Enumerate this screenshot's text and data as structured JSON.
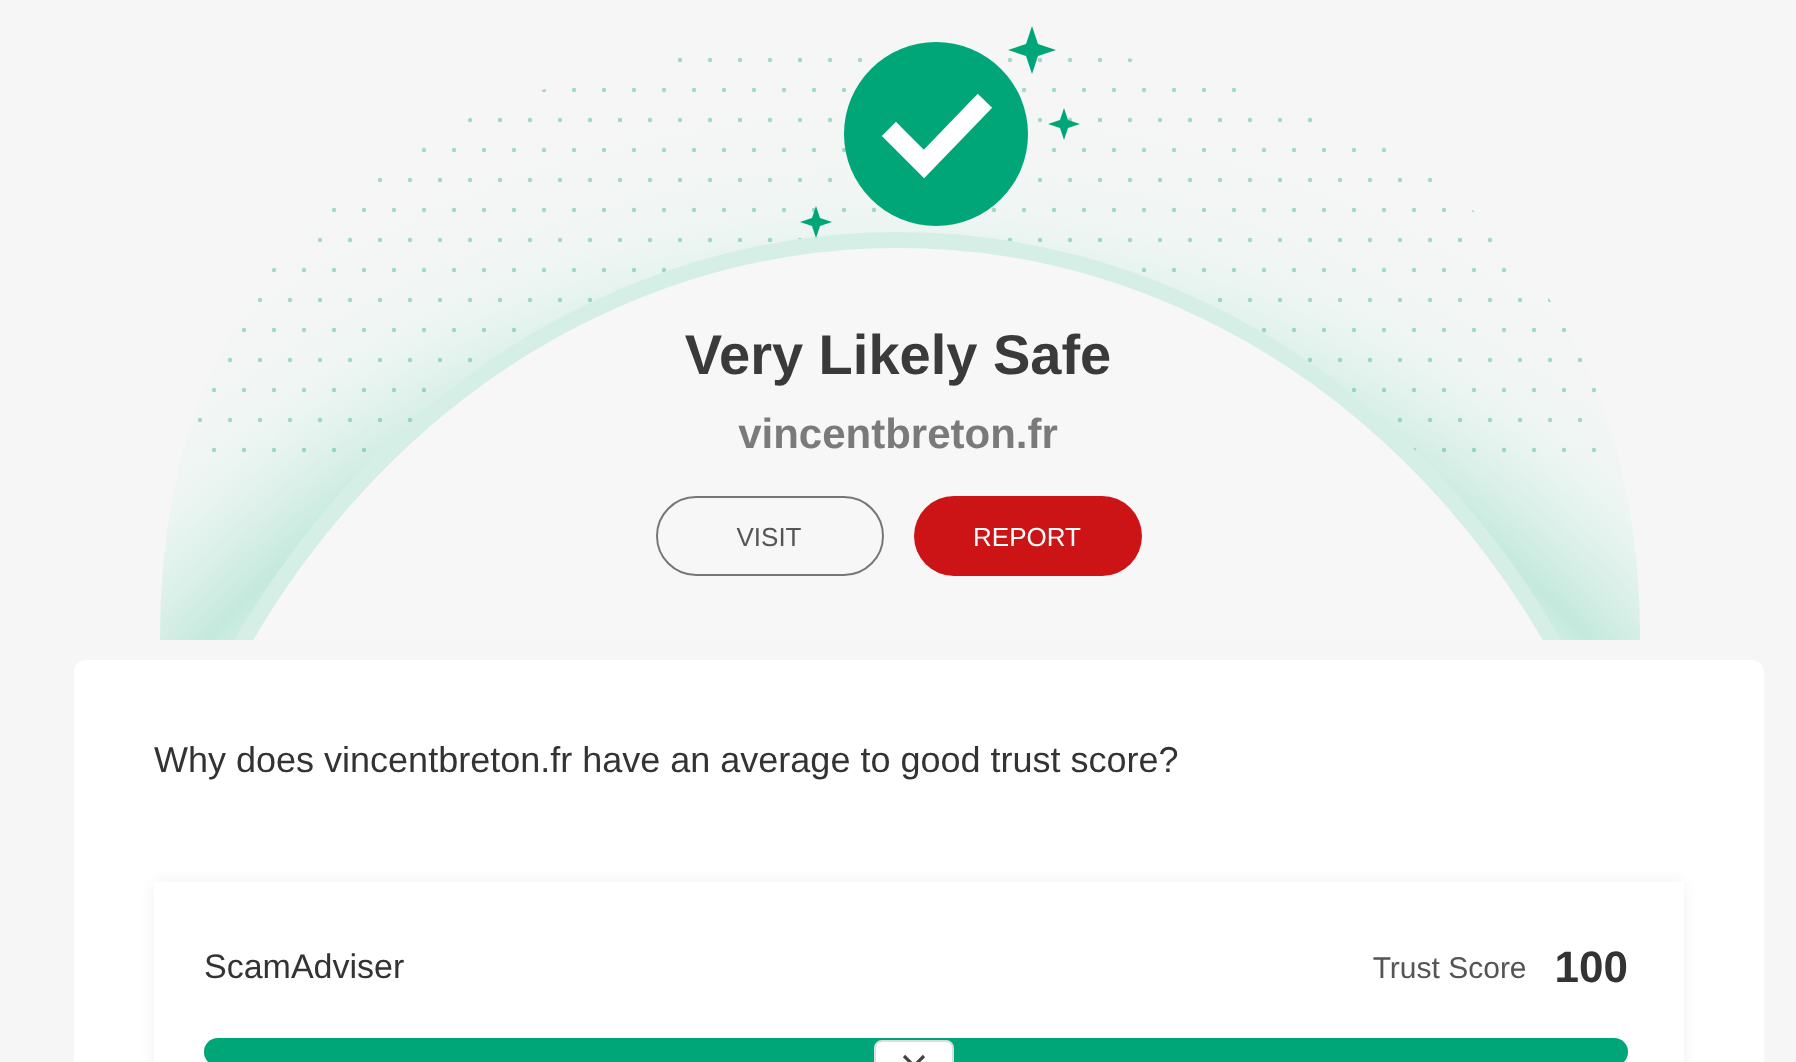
{
  "verdict": {
    "title": "Very Likely Safe",
    "domain": "vincentbreton.fr"
  },
  "buttons": [
    {
      "label": "VISIT",
      "kind": "outline"
    },
    {
      "label": "REPORT",
      "kind": "primary"
    }
  ],
  "card": {
    "question": "Why does vincentbreton.fr have an average to good trust score?",
    "score": {
      "source": "ScamAdviser",
      "label": "Trust Score",
      "value": "100",
      "level": 1
    }
  }
}
